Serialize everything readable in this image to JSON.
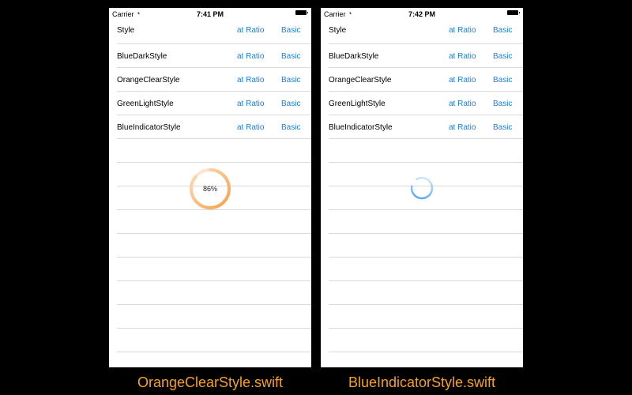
{
  "phones": [
    {
      "status": {
        "carrier": "Carrier",
        "time": "7:41 PM"
      },
      "rows": [
        {
          "name": "Style",
          "ratio": "at Ratio",
          "basic": "Basic"
        },
        {
          "name": "BlueDarkStyle",
          "ratio": "at Ratio",
          "basic": "Basic"
        },
        {
          "name": "OrangeClearStyle",
          "ratio": "at Ratio",
          "basic": "Basic"
        },
        {
          "name": "GreenLightStyle",
          "ratio": "at Ratio",
          "basic": "Basic"
        },
        {
          "name": "BlueIndicatorStyle",
          "ratio": "at Ratio",
          "basic": "Basic"
        }
      ],
      "progress": {
        "label": "86%",
        "value": 0.86,
        "color": "#f7a04b"
      },
      "caption": "OrangeClearStyle.swift"
    },
    {
      "status": {
        "carrier": "Carrier",
        "time": "7:42 PM"
      },
      "rows": [
        {
          "name": "Style",
          "ratio": "at Ratio",
          "basic": "Basic"
        },
        {
          "name": "BlueDarkStyle",
          "ratio": "at Ratio",
          "basic": "Basic"
        },
        {
          "name": "OrangeClearStyle",
          "ratio": "at Ratio",
          "basic": "Basic"
        },
        {
          "name": "GreenLightStyle",
          "ratio": "at Ratio",
          "basic": "Basic"
        },
        {
          "name": "BlueIndicatorStyle",
          "ratio": "at Ratio",
          "basic": "Basic"
        }
      ],
      "indicator": {
        "color": "#4a9cf0"
      },
      "caption": "BlueIndicatorStyle.swift"
    }
  ],
  "colors": {
    "link": "#1a7ee0",
    "caption": "#f7a21b"
  }
}
